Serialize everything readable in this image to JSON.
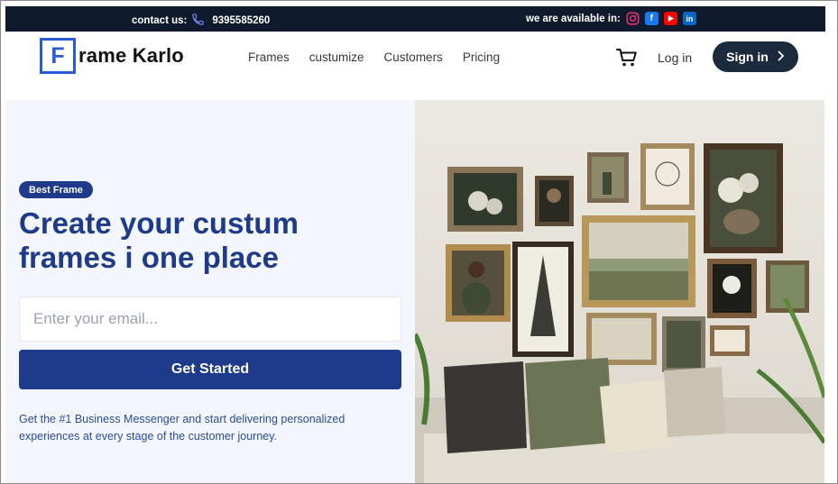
{
  "topbar": {
    "contact_label": "contact us:",
    "phone": "9395585260",
    "available_label": "we are available in:",
    "social": [
      {
        "icon": "instagram-icon",
        "color": "#e1306c"
      },
      {
        "icon": "facebook-icon",
        "color": "#1877f2"
      },
      {
        "icon": "youtube-icon",
        "color": "#ff0000"
      },
      {
        "icon": "linkedin-icon",
        "color": "#0a66c2"
      }
    ]
  },
  "nav": {
    "logo_letter": "F",
    "logo_text": "rame Karlo",
    "links": [
      "Frames",
      "custumize",
      "Customers",
      "Pricing"
    ],
    "login": "Log in",
    "signin": "Sign in"
  },
  "hero": {
    "badge": "Best Frame",
    "headline_line1": "Create your custum",
    "headline_line2": "frames i one place",
    "email_placeholder": "Enter your email...",
    "cta": "Get Started",
    "description": "Get the #1 Business Messenger and start delivering personalized experiences at every stage of the customer journey."
  },
  "colors": {
    "topbar_bg": "#0f1b2d",
    "brand_blue": "#1e3a8a",
    "logo_blue": "#2b5ad6",
    "signin_bg": "#1c2a3e",
    "hero_bg": "#f3f6fc"
  }
}
